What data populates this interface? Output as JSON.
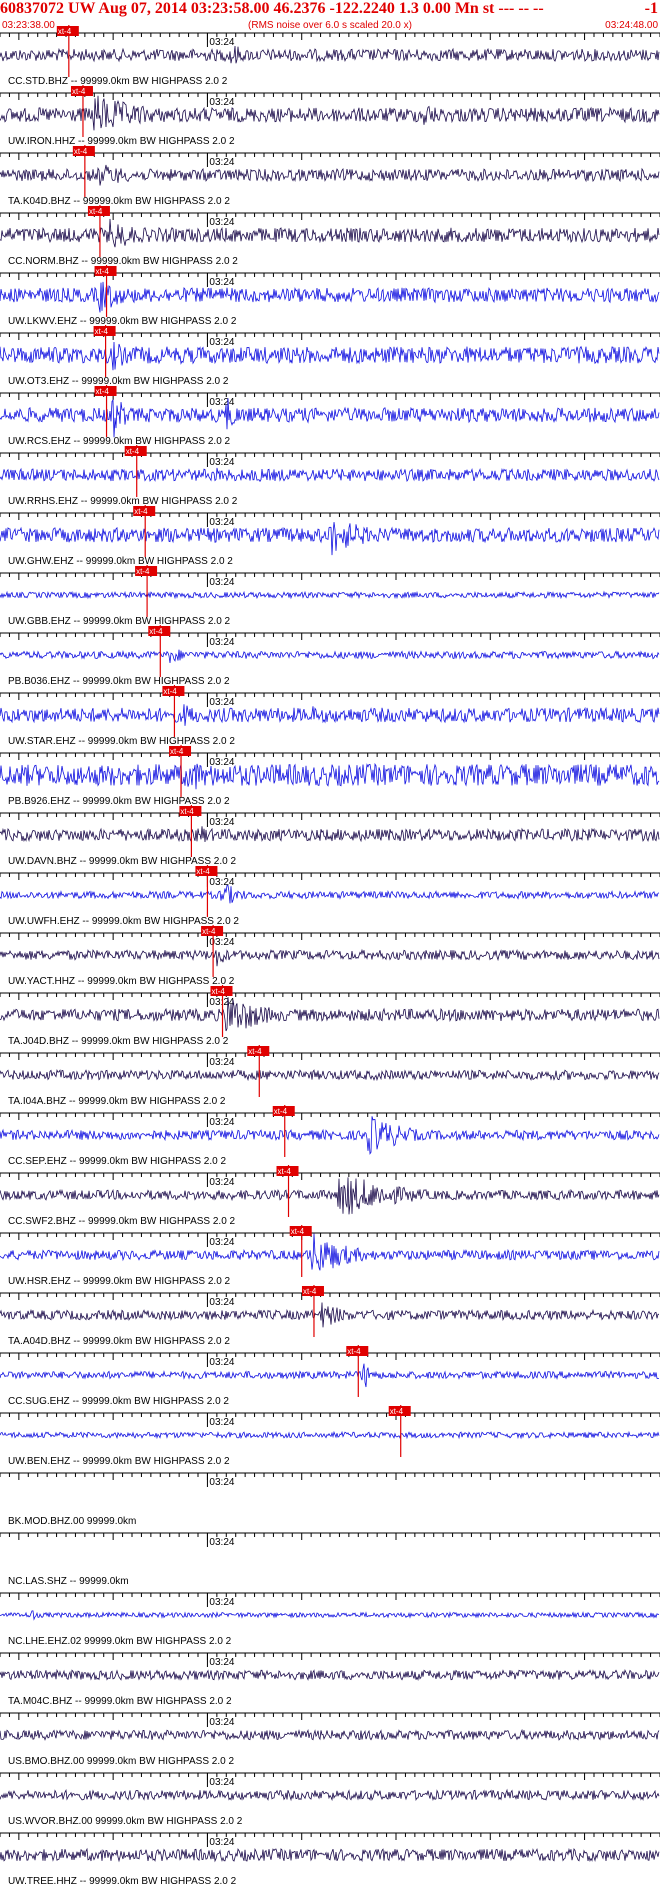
{
  "header": {
    "title": "60837072 UW Aug 07, 2014 03:23:58.00   46.2376 -122.2240  1.3 0.00 Mn st --- -- --",
    "title_right": "-1",
    "start_time": "03:23:38.00",
    "noise_note": "(RMS noise over 6.0 s scaled 20.0 x)",
    "end_time": "03:24:48.00"
  },
  "colors": {
    "header": "#e00000",
    "pick_marker": "#e00000",
    "blue_trace": "#1010e0",
    "dark_trace": "#1a0a4a",
    "axis": "#000000"
  },
  "chart_data": {
    "type": "seismogram-record-section",
    "time_axis": {
      "start": "03:23:38.00",
      "end": "03:24:48.00",
      "minute_label": "03:24",
      "minute_offset_s": 22
    },
    "pick_label": "xt-4",
    "traces": [
      {
        "label": "CC.STD.BHZ -- 99999.0km BW  HIGHPASS  2.0  2",
        "color": "dark",
        "pick_s": 7.3,
        "amp": 0.25,
        "events": [
          [
            24.5,
            0.6,
            1.5
          ]
        ]
      },
      {
        "label": "UW.IRON.HHZ -- 99999.0km BW  HIGHPASS  2.0  2",
        "color": "dark",
        "pick_s": 8.8,
        "amp": 0.3,
        "events": [
          [
            10,
            0.9,
            6
          ],
          [
            45,
            0.6,
            2
          ]
        ]
      },
      {
        "label": "TA.K04D.BHZ -- 99999.0km BW  HIGHPASS  2.0  2",
        "color": "dark",
        "pick_s": 9.0,
        "amp": 0.25,
        "events": [
          [
            10.5,
            0.5,
            5
          ]
        ]
      },
      {
        "label": "CC.NORM.BHZ -- 99999.0km BW  HIGHPASS  2.0  2",
        "color": "dark",
        "pick_s": 10.6,
        "amp": 0.3,
        "events": [
          [
            11.5,
            0.7,
            4
          ]
        ]
      },
      {
        "label": "UW.LKWV.EHZ -- 99999.0km BW  HIGHPASS  2.0  2",
        "color": "blue",
        "pick_s": 11.3,
        "amp": 0.3,
        "events": [
          [
            10.5,
            0.8,
            3
          ]
        ]
      },
      {
        "label": "UW.OT3.EHZ -- 99999.0km BW  HIGHPASS  2.0  2",
        "color": "blue",
        "pick_s": 11.2,
        "amp": 0.35,
        "events": [
          [
            12,
            0.7,
            2
          ]
        ]
      },
      {
        "label": "UW.RCS.EHZ -- 99999.0km BW  HIGHPASS  2.0  2",
        "color": "blue",
        "pick_s": 11.3,
        "amp": 0.3,
        "events": [
          [
            12,
            1.0,
            1.5
          ],
          [
            24,
            0.8,
            1.5
          ]
        ]
      },
      {
        "label": "UW.RRHS.EHZ -- 99999.0km BW  HIGHPASS  2.0  2",
        "color": "blue",
        "pick_s": 14.5,
        "amp": 0.25,
        "events": [
          [
            23,
            0.4,
            0.5
          ],
          [
            27.5,
            0.4,
            0.5
          ],
          [
            42,
            0.3,
            0.5
          ]
        ]
      },
      {
        "label": "UW.GHW.EHZ -- 99999.0km BW  HIGHPASS  2.0  2",
        "color": "blue",
        "pick_s": 15.4,
        "amp": 0.3,
        "events": [
          [
            35,
            0.9,
            4
          ]
        ]
      },
      {
        "label": "UW.GBB.EHZ -- 99999.0km BW  HIGHPASS  2.0  2",
        "color": "blue",
        "pick_s": 15.6,
        "amp": 0.12,
        "events": []
      },
      {
        "label": "PB.B036.EHZ -- 99999.0km BW  HIGHPASS  2.0  2",
        "color": "blue",
        "pick_s": 17.0,
        "amp": 0.15,
        "events": [
          [
            18,
            0.4,
            2
          ]
        ]
      },
      {
        "label": "UW.STAR.EHZ -- 99999.0km BW  HIGHPASS  2.0  2",
        "color": "blue",
        "pick_s": 18.5,
        "amp": 0.3,
        "events": [
          [
            19.5,
            0.5,
            3
          ],
          [
            33,
            0.4,
            3
          ]
        ]
      },
      {
        "label": "PB.B926.EHZ -- 99999.0km BW  HIGHPASS  2.0  2",
        "color": "blue",
        "pick_s": 19.2,
        "amp": 0.45,
        "events": [
          [
            20,
            0.8,
            3
          ]
        ]
      },
      {
        "label": "UW.DAVN.BHZ -- 99999.0km BW  HIGHPASS  2.0  2",
        "color": "dark",
        "pick_s": 20.3,
        "amp": 0.25,
        "events": [
          [
            21,
            0.5,
            2
          ]
        ]
      },
      {
        "label": "UW.UWFH.EHZ -- 99999.0km BW  HIGHPASS  2.0  2",
        "color": "blue",
        "pick_s": 22.0,
        "amp": 0.15,
        "events": [
          [
            23.5,
            0.6,
            2
          ]
        ]
      },
      {
        "label": "UW.YACT.HHZ -- 99999.0km BW  HIGHPASS  2.0  2",
        "color": "dark",
        "pick_s": 22.6,
        "amp": 0.2,
        "events": [
          [
            23,
            0.5,
            1.5
          ]
        ]
      },
      {
        "label": "TA.J04D.BHZ -- 99999.0km BW  HIGHPASS  2.0  2",
        "color": "dark",
        "pick_s": 23.6,
        "amp": 0.25,
        "events": [
          [
            24,
            1.0,
            4
          ]
        ]
      },
      {
        "label": "TA.I04A.BHZ -- 99999.0km BW  HIGHPASS  2.0  2",
        "color": "dark",
        "pick_s": 27.5,
        "amp": 0.2,
        "events": []
      },
      {
        "label": "CC.SEP.EHZ -- 99999.0km BW  HIGHPASS  2.0  2",
        "color": "blue",
        "pick_s": 30.2,
        "amp": 0.2,
        "events": [
          [
            39,
            0.9,
            4
          ]
        ]
      },
      {
        "label": "CC.SWF2.BHZ -- 99999.0km BW  HIGHPASS  2.0  2",
        "color": "dark",
        "pick_s": 30.6,
        "amp": 0.2,
        "events": [
          [
            36,
            1.0,
            6
          ]
        ]
      },
      {
        "label": "UW.HSR.EHZ -- 99999.0km BW  HIGHPASS  2.0  2",
        "color": "blue",
        "pick_s": 32.0,
        "amp": 0.2,
        "events": [
          [
            33,
            1.0,
            4
          ]
        ]
      },
      {
        "label": "TA.A04D.BHZ -- 99999.0km BW  HIGHPASS  2.0  2",
        "color": "dark",
        "pick_s": 33.3,
        "amp": 0.2,
        "events": [
          [
            34,
            0.6,
            3
          ]
        ]
      },
      {
        "label": "CC.SUG.EHZ -- 99999.0km BW  HIGHPASS  2.0  2",
        "color": "blue",
        "pick_s": 38.0,
        "amp": 0.15,
        "events": [
          [
            38.5,
            0.7,
            1
          ]
        ]
      },
      {
        "label": "UW.BEN.EHZ -- 99999.0km BW  HIGHPASS  2.0  2",
        "color": "blue",
        "pick_s": 42.5,
        "amp": 0.12,
        "events": []
      },
      {
        "label": "BK.MOD.BHZ.00 99999.0km",
        "color": "none",
        "pick_s": null,
        "amp": 0,
        "events": []
      },
      {
        "label": "NC.LAS.SHZ -- 99999.0km",
        "color": "none",
        "pick_s": null,
        "amp": 0,
        "events": []
      },
      {
        "label": "NC.LHE.EHZ.02 99999.0km BW  HIGHPASS  2.0  2",
        "color": "blue",
        "pick_s": null,
        "amp": 0.1,
        "events": [
          [
            3.5,
            0.4,
            0.2
          ]
        ]
      },
      {
        "label": "TA.M04C.BHZ -- 99999.0km BW  HIGHPASS  2.0  2",
        "color": "dark",
        "pick_s": null,
        "amp": 0.2,
        "events": []
      },
      {
        "label": "US.BMO.BHZ.00 99999.0km BW  HIGHPASS  2.0  2",
        "color": "dark",
        "pick_s": null,
        "amp": 0.2,
        "events": []
      },
      {
        "label": "US.WVOR.BHZ.00 99999.0km BW  HIGHPASS  2.0  2",
        "color": "dark",
        "pick_s": null,
        "amp": 0.2,
        "events": []
      },
      {
        "label": "UW.TREE.HHZ -- 99999.0km BW  HIGHPASS  2.0  2",
        "color": "dark",
        "pick_s": null,
        "amp": 0.25,
        "events": []
      }
    ]
  }
}
